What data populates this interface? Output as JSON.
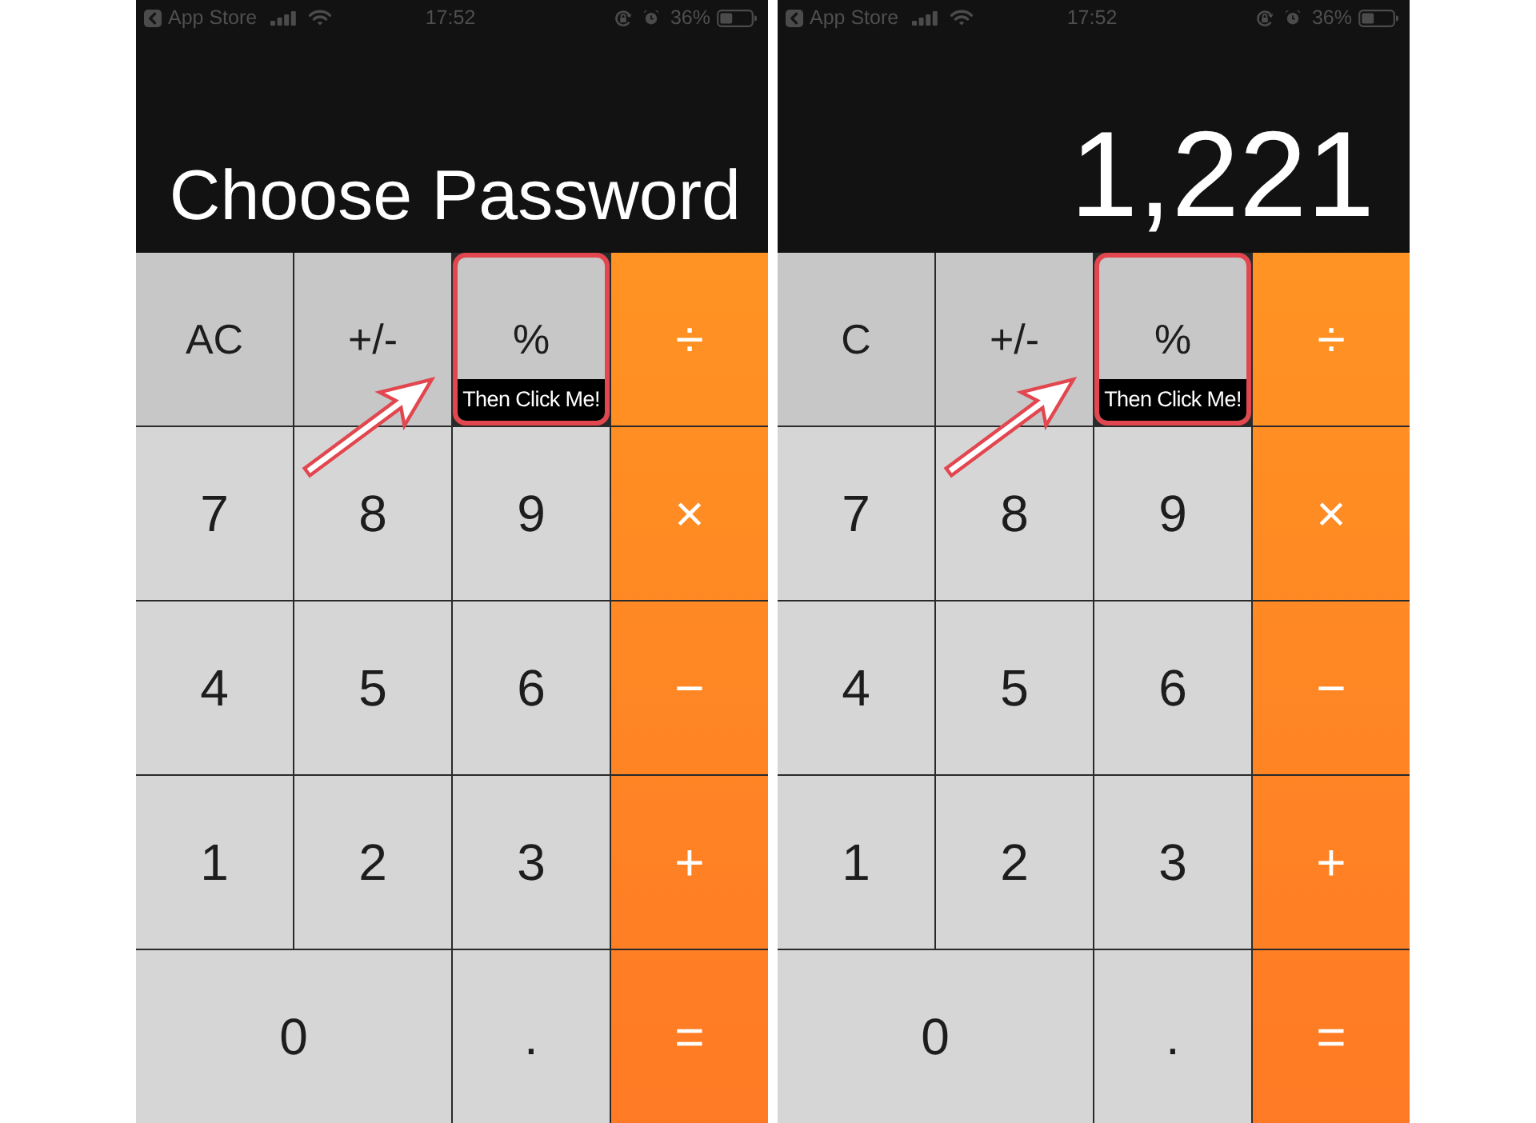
{
  "phones": [
    {
      "status_bar": {
        "back_label": "App Store",
        "time": "17:52",
        "battery": "36%"
      },
      "display": {
        "text": "Choose Password",
        "kind": "prompt"
      },
      "keys": [
        {
          "label": "AC",
          "kind": "function",
          "highlighted": false
        },
        {
          "label": "+/-",
          "kind": "function",
          "highlighted": false
        },
        {
          "label": "%",
          "kind": "function",
          "highlighted": true,
          "callout": "Then Click Me!"
        },
        {
          "label": "÷",
          "kind": "operator",
          "highlighted": false
        },
        {
          "label": "7",
          "kind": "digit",
          "highlighted": false
        },
        {
          "label": "8",
          "kind": "digit",
          "highlighted": false
        },
        {
          "label": "9",
          "kind": "digit",
          "highlighted": false
        },
        {
          "label": "×",
          "kind": "operator",
          "highlighted": false
        },
        {
          "label": "4",
          "kind": "digit",
          "highlighted": false
        },
        {
          "label": "5",
          "kind": "digit",
          "highlighted": false
        },
        {
          "label": "6",
          "kind": "digit",
          "highlighted": false
        },
        {
          "label": "−",
          "kind": "operator",
          "highlighted": false
        },
        {
          "label": "1",
          "kind": "digit",
          "highlighted": false
        },
        {
          "label": "2",
          "kind": "digit",
          "highlighted": false
        },
        {
          "label": "3",
          "kind": "digit",
          "highlighted": false
        },
        {
          "label": "+",
          "kind": "operator",
          "highlighted": false
        },
        {
          "label": "0",
          "kind": "wide",
          "highlighted": false
        },
        {
          "label": ".",
          "kind": "digit",
          "highlighted": false
        },
        {
          "label": "=",
          "kind": "operator",
          "highlighted": false
        }
      ]
    },
    {
      "status_bar": {
        "back_label": "App Store",
        "time": "17:52",
        "battery": "36%"
      },
      "display": {
        "text": "1,221",
        "kind": "number"
      },
      "keys": [
        {
          "label": "C",
          "kind": "function",
          "highlighted": false
        },
        {
          "label": "+/-",
          "kind": "function",
          "highlighted": false
        },
        {
          "label": "%",
          "kind": "function",
          "highlighted": true,
          "callout": "Then Click Me!"
        },
        {
          "label": "÷",
          "kind": "operator",
          "highlighted": false
        },
        {
          "label": "7",
          "kind": "digit",
          "highlighted": false
        },
        {
          "label": "8",
          "kind": "digit",
          "highlighted": false
        },
        {
          "label": "9",
          "kind": "digit",
          "highlighted": false
        },
        {
          "label": "×",
          "kind": "operator",
          "highlighted": false
        },
        {
          "label": "4",
          "kind": "digit",
          "highlighted": false
        },
        {
          "label": "5",
          "kind": "digit",
          "highlighted": false
        },
        {
          "label": "6",
          "kind": "digit",
          "highlighted": false
        },
        {
          "label": "−",
          "kind": "operator",
          "highlighted": false
        },
        {
          "label": "1",
          "kind": "digit",
          "highlighted": false
        },
        {
          "label": "2",
          "kind": "digit",
          "highlighted": false
        },
        {
          "label": "3",
          "kind": "digit",
          "highlighted": false
        },
        {
          "label": "+",
          "kind": "operator",
          "highlighted": false
        },
        {
          "label": "0",
          "kind": "wide",
          "highlighted": false
        },
        {
          "label": ".",
          "kind": "digit",
          "highlighted": false
        },
        {
          "label": "=",
          "kind": "operator",
          "highlighted": false
        }
      ]
    }
  ]
}
